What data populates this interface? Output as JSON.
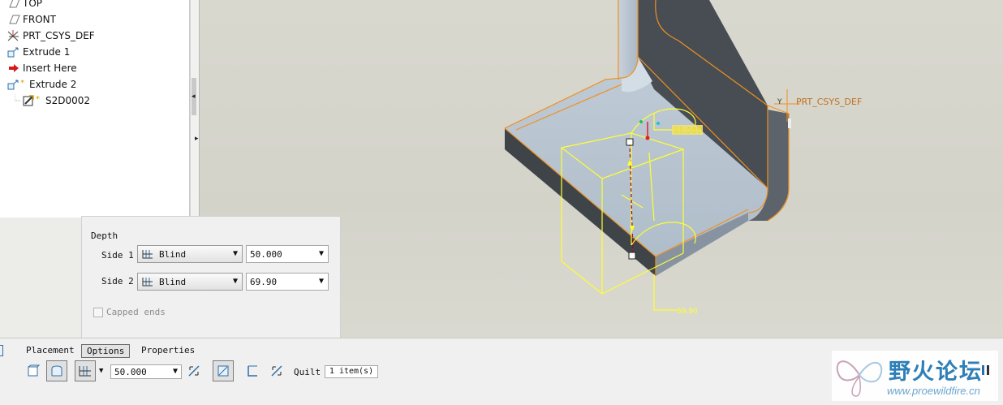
{
  "model_tree": {
    "items": [
      {
        "label": "TOP",
        "icon": "datum-plane-icon"
      },
      {
        "label": "FRONT",
        "icon": "datum-plane-icon"
      },
      {
        "label": "PRT_CSYS_DEF",
        "icon": "csys-icon"
      },
      {
        "label": "Extrude 1",
        "icon": "extrude-icon"
      },
      {
        "label": "Insert Here",
        "icon": "insert-arrow-icon"
      },
      {
        "label": "Extrude 2",
        "icon": "extrude-icon"
      },
      {
        "label": "S2D0002",
        "icon": "sketch-icon"
      }
    ]
  },
  "viewport": {
    "csys_label": "PRT_CSYS_DEF",
    "csys_axis": "Y",
    "dim_side1": "50.000",
    "dim_side2": "69.90",
    "colors": {
      "face_light": "#b9c6d2",
      "face_dark": "#4a5056",
      "edge": "#f09020",
      "preview": "#ffff30"
    }
  },
  "options_panel": {
    "heading": "Depth",
    "side1": {
      "label": "Side 1",
      "type": "Blind",
      "value": "50.000"
    },
    "side2": {
      "label": "Side 2",
      "type": "Blind",
      "value": "69.90"
    },
    "capped_ends": "Capped ends"
  },
  "dashboard": {
    "tabs": [
      "Placement",
      "Options",
      "Properties"
    ],
    "active_tab": "Options",
    "depth_value": "50.000",
    "quilt_label": "Quilt",
    "quilt_value": "1 item(s)"
  },
  "watermark": {
    "title": "野火论坛",
    "url": "www.proewildfire.cn"
  }
}
